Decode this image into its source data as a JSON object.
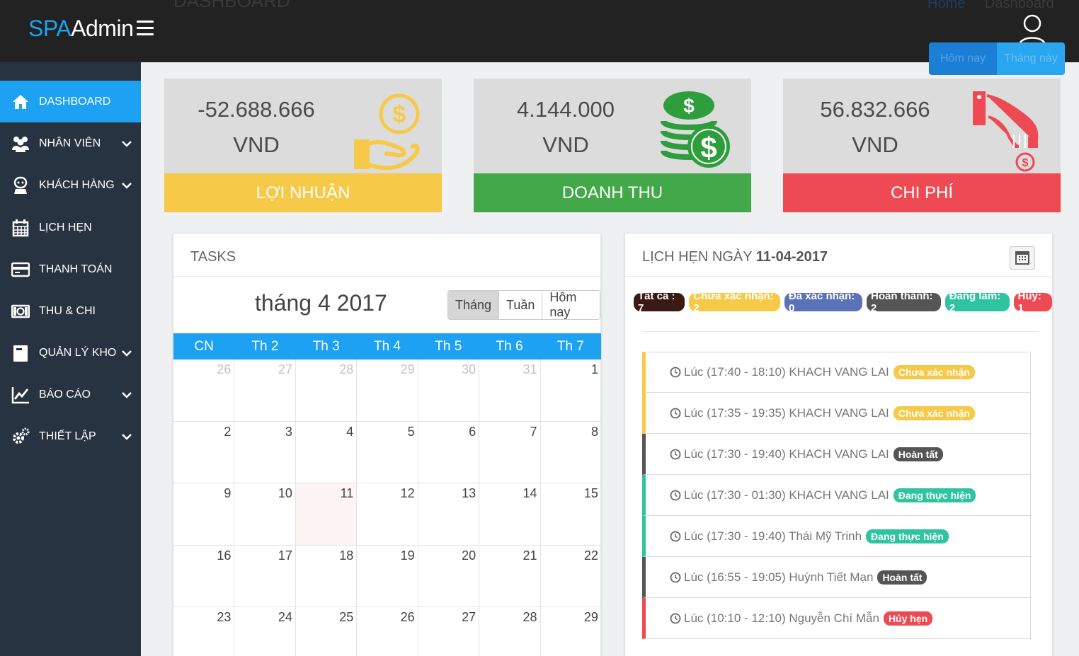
{
  "header": {
    "logo_spa": "SPA",
    "logo_admin": "Admin",
    "page_title": "DASHBOARD",
    "breadcrumb_home": "Home",
    "breadcrumb_current": "Dashboard",
    "range_today": "Hôm nay",
    "range_month": "Tháng này"
  },
  "sidebar": {
    "items": [
      {
        "label": "DASHBOARD",
        "icon": "home-icon",
        "active": true,
        "has_submenu": false
      },
      {
        "label": "NHÂN VIÊN",
        "icon": "users-icon",
        "active": false,
        "has_submenu": true
      },
      {
        "label": "KHÁCH HÀNG",
        "icon": "customer-icon",
        "active": false,
        "has_submenu": true
      },
      {
        "label": "LỊCH HẸN",
        "icon": "calendar-icon",
        "active": false,
        "has_submenu": false
      },
      {
        "label": "THANH TOÁN",
        "icon": "credit-card-icon",
        "active": false,
        "has_submenu": false
      },
      {
        "label": "THU & CHI",
        "icon": "money-icon",
        "active": false,
        "has_submenu": false
      },
      {
        "label": "QUẢN LÝ KHO",
        "icon": "inventory-icon",
        "active": false,
        "has_submenu": true
      },
      {
        "label": "BÁO CÁO",
        "icon": "chart-icon",
        "active": false,
        "has_submenu": true
      },
      {
        "label": "THIẾT LẬP",
        "icon": "gears-icon",
        "active": false,
        "has_submenu": true
      }
    ]
  },
  "stats": {
    "profit": {
      "amount": "-52.688.666",
      "unit": "VND",
      "label": "LỢI NHUẬN",
      "color": "#f7c948",
      "icon": "hand-coin-icon"
    },
    "revenue": {
      "amount": "4.144.000",
      "unit": "VND",
      "label": "DOANH THU",
      "color": "#43a84a",
      "icon": "coin-stack-icon"
    },
    "cost": {
      "amount": "56.832.666",
      "unit": "VND",
      "label": "CHI PHÍ",
      "color": "#ee4a53",
      "icon": "pay-hand-icon"
    }
  },
  "tasks": {
    "title": "TASKS",
    "month_title": "tháng 4 2017",
    "view_buttons": [
      "Tháng",
      "Tuần",
      "Hôm nay"
    ],
    "weekdays": [
      "CN",
      "Th 2",
      "Th 3",
      "Th 4",
      "Th 5",
      "Th 6",
      "Th 7"
    ],
    "weeks": [
      [
        "26",
        "27",
        "28",
        "29",
        "30",
        "31",
        "1"
      ],
      [
        "2",
        "3",
        "4",
        "5",
        "6",
        "7",
        "8"
      ],
      [
        "9",
        "10",
        "11",
        "12",
        "13",
        "14",
        "15"
      ],
      [
        "16",
        "17",
        "18",
        "19",
        "20",
        "21",
        "22"
      ],
      [
        "23",
        "24",
        "25",
        "26",
        "27",
        "28",
        "29"
      ]
    ],
    "today": "11"
  },
  "appointments": {
    "title_prefix": "LỊCH HẸN NGÀY",
    "title_date": "11-04-2017",
    "filters": [
      {
        "label": "Tất cả : 7",
        "color": "#3a1a14"
      },
      {
        "label": "Chưa xác nhận: 2",
        "color": "#f7c948"
      },
      {
        "label": "Đã xác nhận: 0",
        "color": "#5b72b8"
      },
      {
        "label": "Hoàn thành: 2",
        "color": "#555555"
      },
      {
        "label": "Đang làm: 2",
        "color": "#2ec4a0"
      },
      {
        "label": "Huỷ: 1",
        "color": "#ee4a53"
      }
    ],
    "items": [
      {
        "text": "Lúc (17:40 - 18:10) KHACH VANG LAI",
        "status": "Chưa xác nhận",
        "color": "#f7c948"
      },
      {
        "text": "Lúc (17:35 - 19:35) KHACH VANG LAI",
        "status": "Chưa xác nhận",
        "color": "#f7c948"
      },
      {
        "text": "Lúc (17:30 - 19:40) KHACH VANG LAI",
        "status": "Hoàn tất",
        "color": "#555555"
      },
      {
        "text": "Lúc (17:30 - 01:30) KHACH VANG LAI",
        "status": "Đang thực hiện",
        "color": "#2ec4a0"
      },
      {
        "text": "Lúc (17:30 - 19:40) Thái Mỹ Trinh",
        "status": "Đang thực hiện",
        "color": "#2ec4a0"
      },
      {
        "text": "Lúc (16:55 - 19:05) Huỳnh Tiết Mạn",
        "status": "Hoàn tất",
        "color": "#555555"
      },
      {
        "text": "Lúc (10:10 - 12:10) Nguyễn Chí Mẫn",
        "status": "Hủy hẹn",
        "color": "#ee4a53"
      }
    ]
  }
}
